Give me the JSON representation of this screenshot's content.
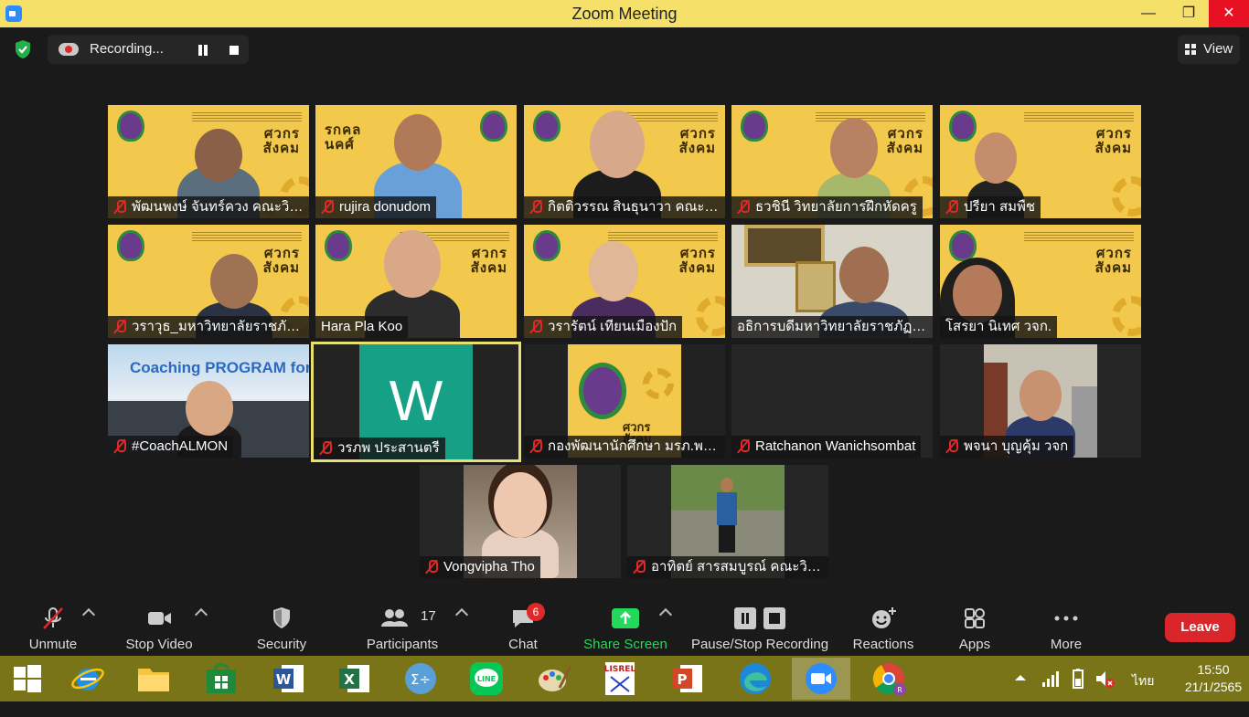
{
  "window": {
    "title": "Zoom Meeting",
    "minimize": "—",
    "maximize": "❐",
    "close": "✕"
  },
  "recording": {
    "label": "Recording..."
  },
  "view": {
    "label": "View"
  },
  "tiles": [
    {
      "name": "พัฒนพงษ์ จันทร์ควง คณะวิทยา...",
      "muted": true,
      "bg": "yellow"
    },
    {
      "name": "rujira donudom",
      "muted": true,
      "bg": "yellow"
    },
    {
      "name": "กิตติวรรณ สินธุนาวา คณะวิทยา...",
      "muted": true,
      "bg": "yellow"
    },
    {
      "name": "ธวชินี  วิทยาลัยการฝึกหัดครู",
      "muted": true,
      "bg": "yellow"
    },
    {
      "name": "ปรียา สมพืช",
      "muted": true,
      "bg": "yellow"
    },
    {
      "name": "วราวุธ_มหาวิทยาลัยราชภัฏพร...",
      "muted": true,
      "bg": "yellow"
    },
    {
      "name": "Hara Pla Koo",
      "muted": false,
      "bg": "yellow"
    },
    {
      "name": "วรารัตน์ เทียนเมืองปัก",
      "muted": true,
      "bg": "yellow"
    },
    {
      "name": "อธิการบดีมหาวิทยาลัยราชภัฏพระ...",
      "muted": false,
      "bg": "office"
    },
    {
      "name": "โสรยา นิเทศ วจก.",
      "muted": false,
      "bg": "yellow"
    },
    {
      "name": "#CoachALMON",
      "muted": true,
      "bg": "coach",
      "banner": "Coaching PROGRAM for Lecturer"
    },
    {
      "name": "วรภพ ประสานตรี",
      "muted": true,
      "bg": "avatar",
      "initial": "W",
      "active": true
    },
    {
      "name": "กองพัฒนานักศึกษา มรภ.พระ...",
      "muted": true,
      "bg": "logo"
    },
    {
      "name": "Ratchanon Wanichsombat",
      "muted": true,
      "bg": "dark"
    },
    {
      "name": "พจนา บุญคุ้ม วจก",
      "muted": true,
      "bg": "room"
    },
    {
      "name": "Vongvipha Tho",
      "muted": true,
      "bg": "selfie"
    },
    {
      "name": "อาทิตย์ สารสมบูรณ์ คณะวิทยา...",
      "muted": true,
      "bg": "run"
    }
  ],
  "brand_text": "ศวกร\nสังคม",
  "toolbar": {
    "unmute": "Unmute",
    "stop_video": "Stop Video",
    "security": "Security",
    "participants": "Participants",
    "participants_count": "17",
    "chat": "Chat",
    "chat_badge": "6",
    "share_screen": "Share Screen",
    "pause_stop_recording": "Pause/Stop Recording",
    "reactions": "Reactions",
    "apps": "Apps",
    "more": "More",
    "leave": "Leave"
  },
  "taskbar": {
    "lang": "ไทย",
    "time": "15:50",
    "date": "21/1/2565",
    "apps": [
      "start",
      "internet-explorer",
      "file-explorer",
      "store",
      "word",
      "excel",
      "math-input",
      "line",
      "paint",
      "lisrel",
      "powerpoint",
      "edge",
      "zoom",
      "chrome"
    ]
  },
  "colors": {
    "titlebar": "#f5e06a",
    "meeting_bg": "#1a1a1a",
    "tile_yellow": "#f2c94c",
    "share_green": "#23d959",
    "leave_red": "#d9262a",
    "taskbar": "#7a7418"
  }
}
